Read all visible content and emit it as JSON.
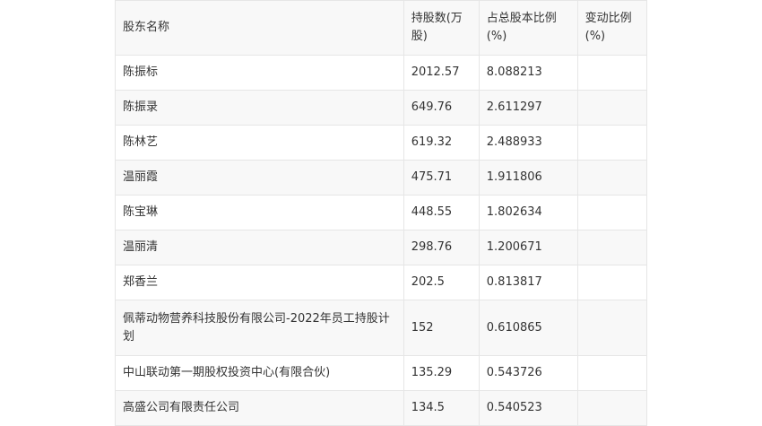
{
  "table": {
    "headers": [
      "股东名称",
      "持股数(万股)",
      "占总股本比例(%)",
      "变动比例(%)"
    ],
    "rows": [
      [
        "陈振标",
        "2012.57",
        "8.088213",
        ""
      ],
      [
        "陈振录",
        "649.76",
        "2.611297",
        ""
      ],
      [
        "陈林艺",
        "619.32",
        "2.488933",
        ""
      ],
      [
        "温丽霞",
        "475.71",
        "1.911806",
        ""
      ],
      [
        "陈宝琳",
        "448.55",
        "1.802634",
        ""
      ],
      [
        "温丽清",
        "298.76",
        "1.200671",
        ""
      ],
      [
        "郑香兰",
        "202.5",
        "0.813817",
        ""
      ],
      [
        "佩蒂动物营养科技股份有限公司-2022年员工持股计划",
        "152",
        "0.610865",
        ""
      ],
      [
        "中山联动第一期股权投资中心(有限合伙)",
        "135.29",
        "0.543726",
        ""
      ],
      [
        "高盛公司有限责任公司",
        "134.5",
        "0.540523",
        ""
      ]
    ]
  }
}
